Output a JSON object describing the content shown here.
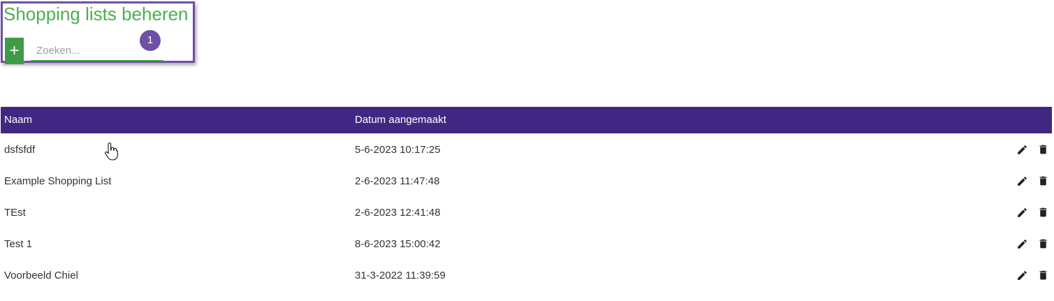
{
  "header": {
    "title": "Shopping lists beheren",
    "add_label": "+",
    "search_placeholder": "Zoeken...",
    "step_number": "1"
  },
  "table": {
    "columns": [
      "Naam",
      "Datum aangemaakt"
    ],
    "rows": [
      {
        "name": "dsfsfdf",
        "date": "5-6-2023 10:17:25"
      },
      {
        "name": "Example Shopping List",
        "date": "2-6-2023 11:47:48"
      },
      {
        "name": "TEst",
        "date": "2-6-2023 12:41:48"
      },
      {
        "name": "Test 1",
        "date": "8-6-2023 15:00:42"
      },
      {
        "name": "Voorbeeld Chiel",
        "date": "31-3-2022 11:39:59"
      }
    ],
    "row_action_icons": [
      "pencil-icon",
      "trash-icon"
    ]
  },
  "colors": {
    "title_green": "#4caf50",
    "add_button_green": "#3e9b47",
    "header_purple": "#402882",
    "highlight_purple": "#6e51a6"
  }
}
